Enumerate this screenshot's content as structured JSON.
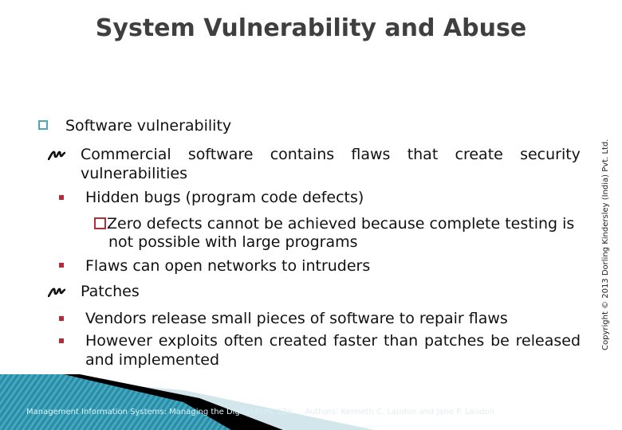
{
  "slide": {
    "title": "System Vulnerability and Abuse",
    "section": {
      "label": "Software vulnerability",
      "bullet_icon": "hollow-square-icon",
      "items": [
        {
          "label_line1": [
            "Commercial",
            "software",
            "contains",
            "flaws",
            "that",
            "create",
            "security"
          ],
          "label_line2": "vulnerabilities",
          "bullet_icon": "scribble-arrow-icon",
          "subitems": [
            {
              "label": "Hidden bugs (program code defects)",
              "bullet_icon": "red-square-bullet-icon",
              "subsubitems": [
                {
                  "line1": "Zero defects cannot be achieved because complete testing is",
                  "line2": "not possible with large programs",
                  "bullet_icon": "hollow-red-square-icon"
                }
              ]
            },
            {
              "label": "Flaws can open networks to intruders",
              "bullet_icon": "red-square-bullet-icon"
            }
          ]
        },
        {
          "label_line1": [
            "Patches"
          ],
          "bullet_icon": "scribble-arrow-icon",
          "subitems": [
            {
              "label": "Vendors release small pieces of software to repair flaws",
              "bullet_icon": "red-square-bullet-icon"
            },
            {
              "label_line1": "However exploits often created faster than patches be released",
              "label_line2": "and implemented",
              "bullet_icon": "red-square-bullet-icon"
            }
          ]
        }
      ]
    }
  },
  "sidebar": {
    "copyright": "Copyright © 2013 Dorling Kindersley (India) Pvt. Ltd."
  },
  "footer": {
    "book": "Management Information Systems: Managing the Digital Firm, 12e",
    "authors": "Authors: Kenneth C. Laudon and Jane P. Laudon",
    "colors": {
      "teal_dark": "#0f6f86",
      "teal_light": "#4fb3cc",
      "band_black": "#000000",
      "band_light": "#d3e6ec"
    }
  },
  "colors": {
    "title": "#3f3f3f",
    "accent_teal": "#4fa6b4",
    "accent_red": "#b22d3a"
  }
}
